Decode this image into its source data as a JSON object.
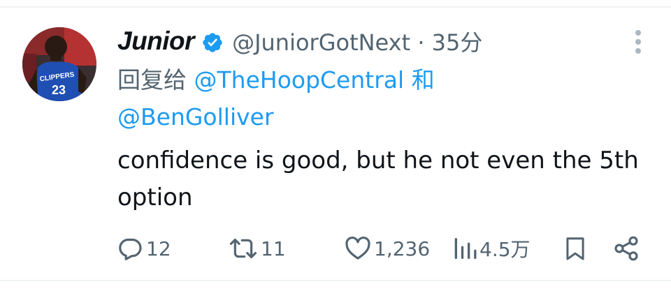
{
  "tweet": {
    "display_name": "Junior",
    "handle": "@JuniorGotNext",
    "separator": "·",
    "time": "35分",
    "reply_prefix": "回复给",
    "reply_mention_1": "@TheHoopCentral",
    "reply_joiner": "和",
    "reply_mention_2": "@BenGolliver",
    "text": "confidence is good, but he not even the 5th option"
  },
  "actions": {
    "replies": "12",
    "retweets": "11",
    "likes": "1,236",
    "views": "4.5万"
  },
  "avatar": {
    "jersey_text": "CLIPPERS",
    "jersey_number": "23"
  },
  "colors": {
    "text": "#0f1419",
    "secondary": "#536471",
    "link": "#1d9bf0",
    "verified": "#1d9bf0",
    "divider": "#eff3f4"
  }
}
